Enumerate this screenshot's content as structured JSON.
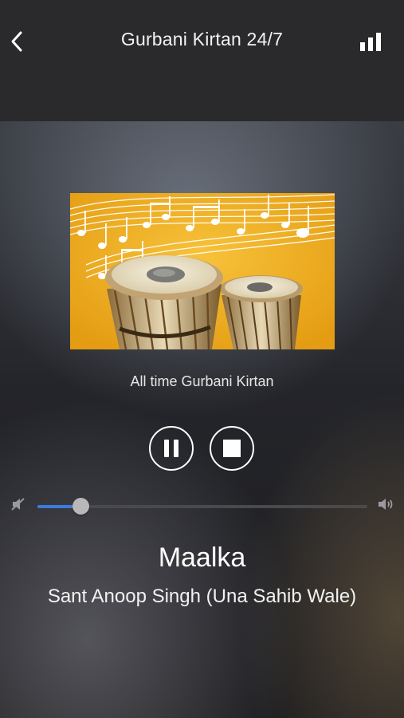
{
  "header": {
    "title": "Gurbani Kirtan 24/7",
    "back_icon": "chevron-left-icon",
    "stats_icon": "bar-chart-icon"
  },
  "player": {
    "artwork": "tabla-music-notes-image",
    "station_subtitle": "All time Gurbani Kirtan",
    "state": "playing",
    "pause_icon": "pause-icon",
    "stop_icon": "stop-icon",
    "volume": 0.13,
    "track_title": "Maalka",
    "track_artist": "Sant Anoop Singh (Una Sahib Wale)"
  },
  "colors": {
    "accent": "#3b7bdc",
    "artwork_yellow": "#f0b21f"
  }
}
